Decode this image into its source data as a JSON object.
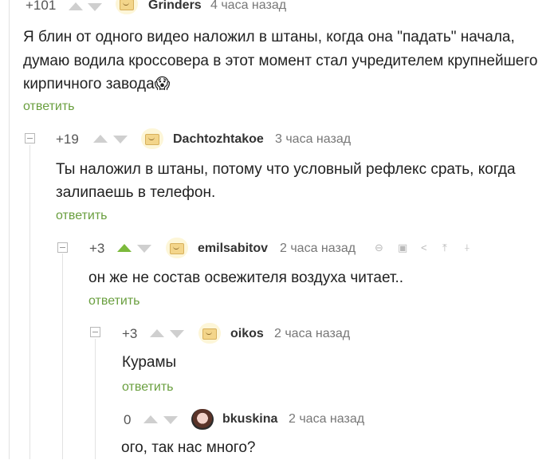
{
  "comments": [
    {
      "score": "+101",
      "author": "Grinders",
      "time": "4 часа назад",
      "text": [
        "Я блин от одного видео наложил в штаны, когда она \"падать\" начала,",
        "думаю водила кроссовера в этот момент стал учредителем крупнейшего",
        "кирпичного завода😱"
      ],
      "reply": "ответить"
    },
    {
      "score": "+19",
      "author": "Dachtozhtakoe",
      "time": "3 часа назад",
      "text": [
        "Ты наложил в штаны, потому что условный рефлекс срать, когда",
        "залипаешь в телефон."
      ],
      "reply": "ответить"
    },
    {
      "score": "+3",
      "author": "emilsabitov",
      "time": "2 часа назад",
      "text": [
        "он же не состав освежителя воздуха читает.."
      ],
      "reply": "ответить",
      "tools": [
        "link-icon",
        "save-icon",
        "share-icon",
        "to-top-icon",
        "more-icon"
      ]
    },
    {
      "score": "+3",
      "author": "oikos",
      "time": "2 часа назад",
      "text": [
        "Курамы"
      ],
      "reply": "ответить"
    },
    {
      "score": "0",
      "author": "bkuskina",
      "time": "2 часа назад",
      "text": [
        "ого, так нас много?"
      ]
    }
  ],
  "colors": {
    "reply": "#6a9f3f",
    "upvote_active": "#7cba3c",
    "arrow_idle": "#cfcfcf",
    "thread_line": "#e2e2e2"
  }
}
